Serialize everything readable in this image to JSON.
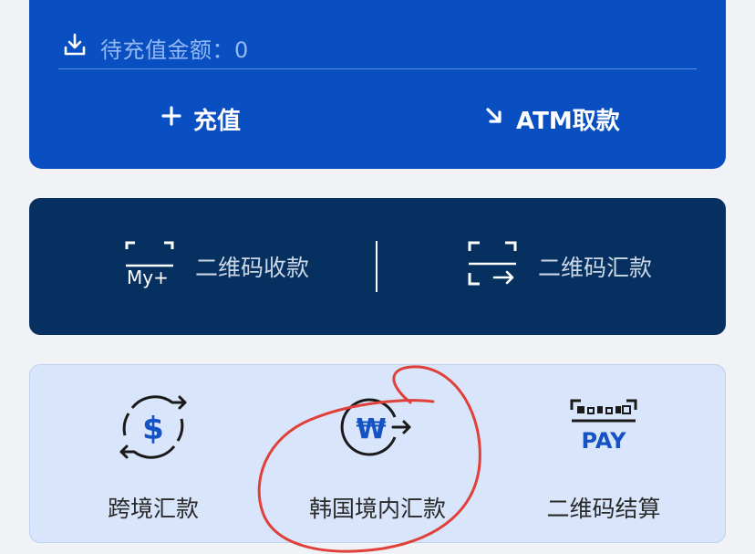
{
  "balance_card": {
    "pending_amount_text": "待充值金额：0",
    "actions": [
      {
        "label": "充值",
        "icon": "plus-icon"
      },
      {
        "label": "ATM取款",
        "icon": "arrow-down-right-icon"
      }
    ]
  },
  "qr_card": {
    "collect": {
      "label": "二维码收款",
      "icon_text": "My+"
    },
    "transfer": {
      "label": "二维码汇款"
    }
  },
  "services": [
    {
      "label": "跨境汇款",
      "icon": "cross-border-exchange-icon"
    },
    {
      "label": "韩国境内汇款",
      "icon": "won-transfer-icon",
      "icon_text": "₩"
    },
    {
      "label": "二维码结算",
      "icon": "qr-pay-icon",
      "icon_text": "PAY"
    }
  ],
  "colors": {
    "primary_blue": "#0a4fc2",
    "navy": "#05305f",
    "light_blue": "#d8e5fb",
    "annotation_red": "#e0403a"
  }
}
